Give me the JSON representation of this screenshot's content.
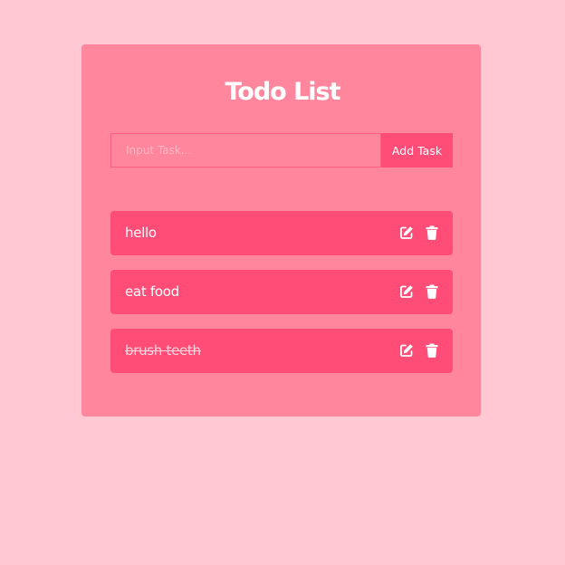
{
  "app": {
    "title": "Todo List"
  },
  "input": {
    "placeholder": "Input Task...",
    "value": "",
    "add_label": "Add Task"
  },
  "todos": [
    {
      "text": "hello",
      "completed": false
    },
    {
      "text": "eat food",
      "completed": false
    },
    {
      "text": "brush teeth",
      "completed": true
    }
  ],
  "icons": {
    "edit": "edit-icon",
    "delete": "trash-icon"
  },
  "colors": {
    "background": "#ffc8d2",
    "card": "#ff869c",
    "accent": "#ff4d78",
    "text": "#ffffff"
  }
}
